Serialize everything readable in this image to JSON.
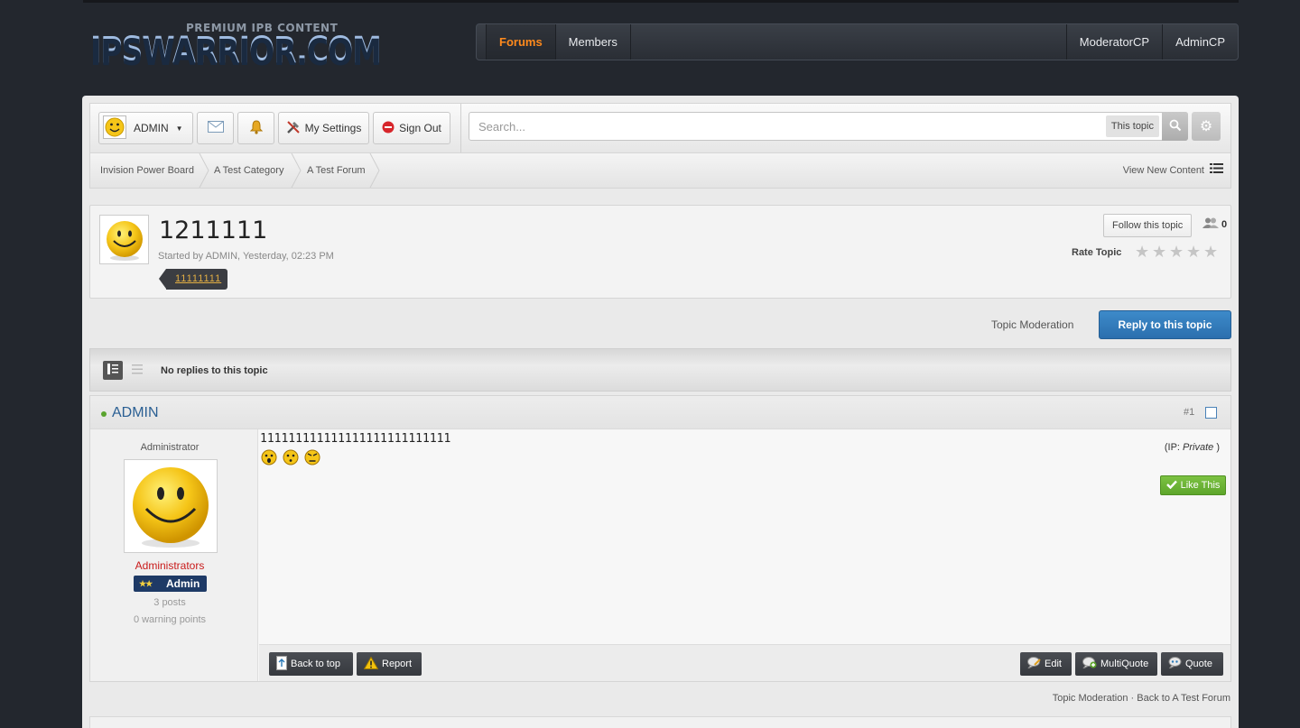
{
  "logo": {
    "tagline": "PREMIUM IPB CONTENT",
    "name": "IPSWARRIOR.COM"
  },
  "nav": {
    "left": [
      "Forums",
      "Members"
    ],
    "right": [
      "ModeratorCP",
      "AdminCP"
    ],
    "active": "Forums"
  },
  "userbar": {
    "username": "ADMIN",
    "my_settings": "My Settings",
    "sign_out": "Sign Out",
    "search_placeholder": "Search...",
    "search_scope": "This topic"
  },
  "breadcrumb": {
    "items": [
      "Invision Power Board",
      "A Test Category",
      "A Test Forum"
    ],
    "view_new_content": "View New Content"
  },
  "topic": {
    "title": "1211111",
    "meta": "Started by ADMIN, Yesterday, 02:23 PM",
    "tag": "11111111",
    "follow_label": "Follow this topic",
    "follower_count": "0",
    "rate_label": "Rate Topic",
    "rating_stars": 5
  },
  "actions": {
    "topic_moderation": "Topic Moderation",
    "reply": "Reply to this topic"
  },
  "modebar": {
    "status": "No replies to this topic"
  },
  "post": {
    "author": "ADMIN",
    "number": "#1",
    "author_title": "Administrator",
    "group": "Administrators",
    "rank": "Admin",
    "posts": "3 posts",
    "warnings": "0 warning points",
    "content": "111111111111111111111111111",
    "ip_prefix": "(IP: ",
    "ip_value": "Private",
    "ip_suffix": " )",
    "like": "Like This",
    "buttons_left": [
      "Back to top",
      "Report"
    ],
    "buttons_right": [
      "Edit",
      "MultiQuote",
      "Quote"
    ]
  },
  "footer_links": {
    "moderation": "Topic Moderation",
    "separator": " · ",
    "back": "Back to A Test Forum"
  },
  "colors": {
    "accent_orange": "#ff8a1c",
    "reply_blue": "#2b6fae",
    "like_green": "#5ea62b",
    "group_red": "#c91a1a",
    "rank_navy": "#1e3a66"
  }
}
